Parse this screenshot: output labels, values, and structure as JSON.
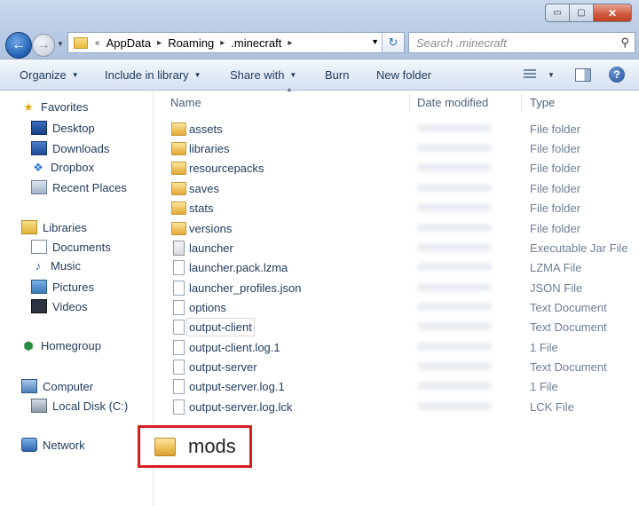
{
  "window": {
    "controls": {
      "minimize": "▭",
      "maximize": "▢",
      "close": "✕"
    }
  },
  "address": {
    "chevron": "«",
    "crumbs": [
      "AppData",
      "Roaming",
      ".minecraft"
    ],
    "search_placeholder": "Search .minecraft"
  },
  "toolbar": {
    "organize": "Organize",
    "include_in_library": "Include in library",
    "share_with": "Share with",
    "burn": "Burn",
    "new_folder": "New folder",
    "help": "?"
  },
  "nav": {
    "favorites": "Favorites",
    "desktop": "Desktop",
    "downloads": "Downloads",
    "dropbox": "Dropbox",
    "recent_places": "Recent Places",
    "libraries": "Libraries",
    "documents": "Documents",
    "music": "Music",
    "pictures": "Pictures",
    "videos": "Videos",
    "homegroup": "Homegroup",
    "computer": "Computer",
    "local_disk": "Local Disk (C:)",
    "network": "Network"
  },
  "columns": {
    "name": "Name",
    "date_modified": "Date modified",
    "type": "Type"
  },
  "files": [
    {
      "name": "assets",
      "type": "File folder",
      "icon": "folder-icon"
    },
    {
      "name": "libraries",
      "type": "File folder",
      "icon": "folder-icon"
    },
    {
      "name": "resourcepacks",
      "type": "File folder",
      "icon": "folder-icon"
    },
    {
      "name": "saves",
      "type": "File folder",
      "icon": "folder-icon"
    },
    {
      "name": "stats",
      "type": "File folder",
      "icon": "folder-icon"
    },
    {
      "name": "versions",
      "type": "File folder",
      "icon": "folder-icon"
    },
    {
      "name": "launcher",
      "type": "Executable Jar File",
      "icon": "jar-file-icon"
    },
    {
      "name": "launcher.pack.lzma",
      "type": "LZMA File",
      "icon": "file-icon"
    },
    {
      "name": "launcher_profiles.json",
      "type": "JSON File",
      "icon": "file-icon"
    },
    {
      "name": "options",
      "type": "Text Document",
      "icon": "file-icon"
    },
    {
      "name": "output-client",
      "type": "Text Document",
      "icon": "file-icon"
    },
    {
      "name": "output-client.log.1",
      "type": "1 File",
      "icon": "file-icon"
    },
    {
      "name": "output-server",
      "type": "Text Document",
      "icon": "file-icon"
    },
    {
      "name": "output-server.log.1",
      "type": "1 File",
      "icon": "file-icon"
    },
    {
      "name": "output-server.log.lck",
      "type": "LCK File",
      "icon": "file-icon"
    }
  ],
  "callout": {
    "label": "mods",
    "highlight_color": "#d61f1f"
  }
}
